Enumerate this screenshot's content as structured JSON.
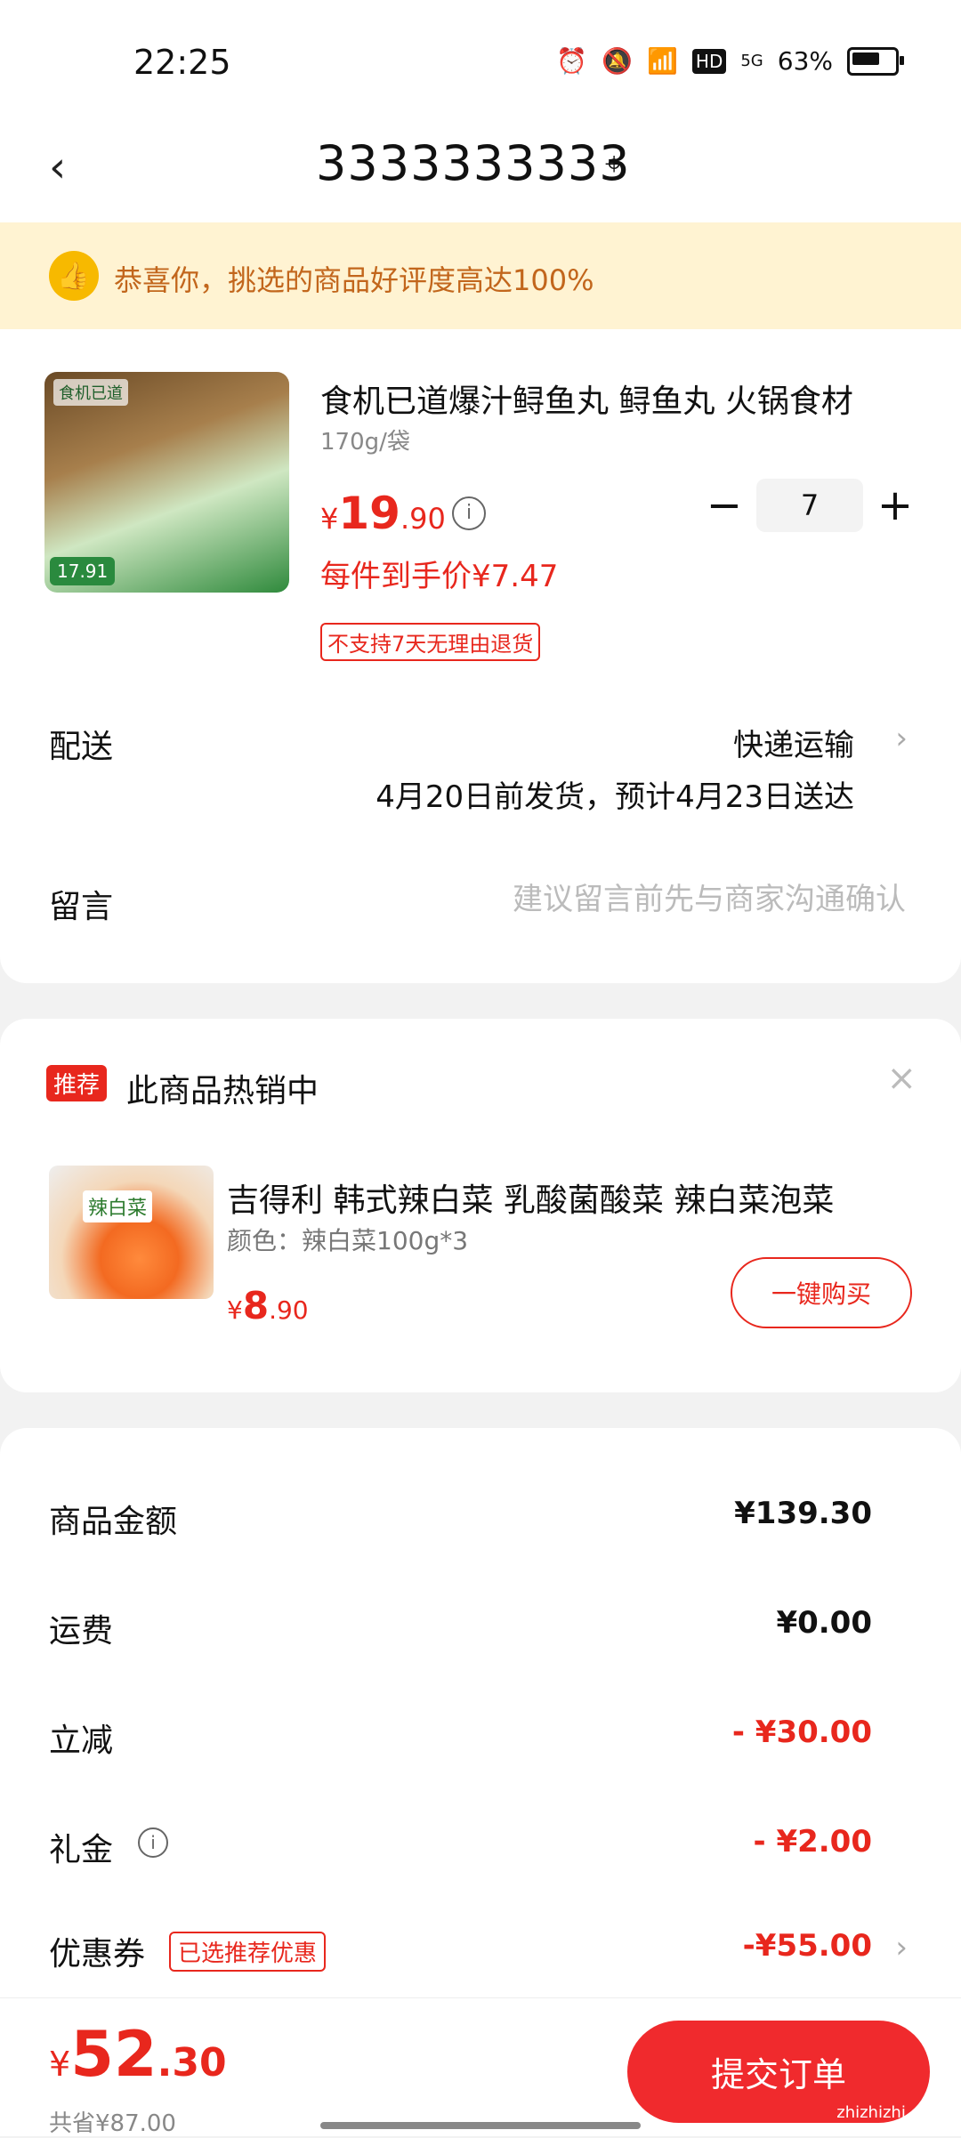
{
  "status": {
    "time": "22:25",
    "battery": "63%",
    "net": "5G",
    "hd": "HD"
  },
  "header": {
    "back": "‹",
    "address": "3333333333"
  },
  "banner": {
    "text": "恭喜你，挑选的商品好评度高达100%"
  },
  "product": {
    "title": "食机已道爆汁鲟鱼丸  鲟鱼丸 火锅食材",
    "spec": "170g/袋",
    "img_top": "食机已道",
    "img_tag": "17.91",
    "price_symbol": "¥",
    "price_int": "19",
    "price_dec": ".90",
    "each_price": "每件到手价¥7.47",
    "no_return": "不支持7天无理由退货",
    "qty": "7"
  },
  "shipping": {
    "label": "配送",
    "method": "快递运输",
    "eta": "4月20日前发货，预计4月23日送达"
  },
  "message": {
    "label": "留言",
    "placeholder": "建议留言前先与商家沟通确认"
  },
  "recommend": {
    "badge": "推荐",
    "title": "此商品热销中",
    "name": "吉得利 韩式辣白菜  乳酸菌酸菜 辣白菜泡菜",
    "spec": "颜色：辣白菜100g*3",
    "img_label": "辣白菜",
    "price_symbol": "¥",
    "price_int": "8",
    "price_dec": ".90",
    "buy": "一键购买"
  },
  "summary": {
    "goods_label": "商品金额",
    "goods": "¥139.30",
    "freight_label": "运费",
    "freight": "¥0.00",
    "discount_label": "立减",
    "discount": "- ¥30.00",
    "gift_label": "礼金",
    "gift": "- ¥2.00",
    "coupon_label": "优惠券",
    "coupon_tag": "已选推荐优惠",
    "coupon": "-¥55.00"
  },
  "footer": {
    "price_symbol": "¥",
    "price_int": "52",
    "price_dec": ".30",
    "saved": "共省¥87.00",
    "submit": "提交订单",
    "watermark": "zhizhizhi.com"
  }
}
